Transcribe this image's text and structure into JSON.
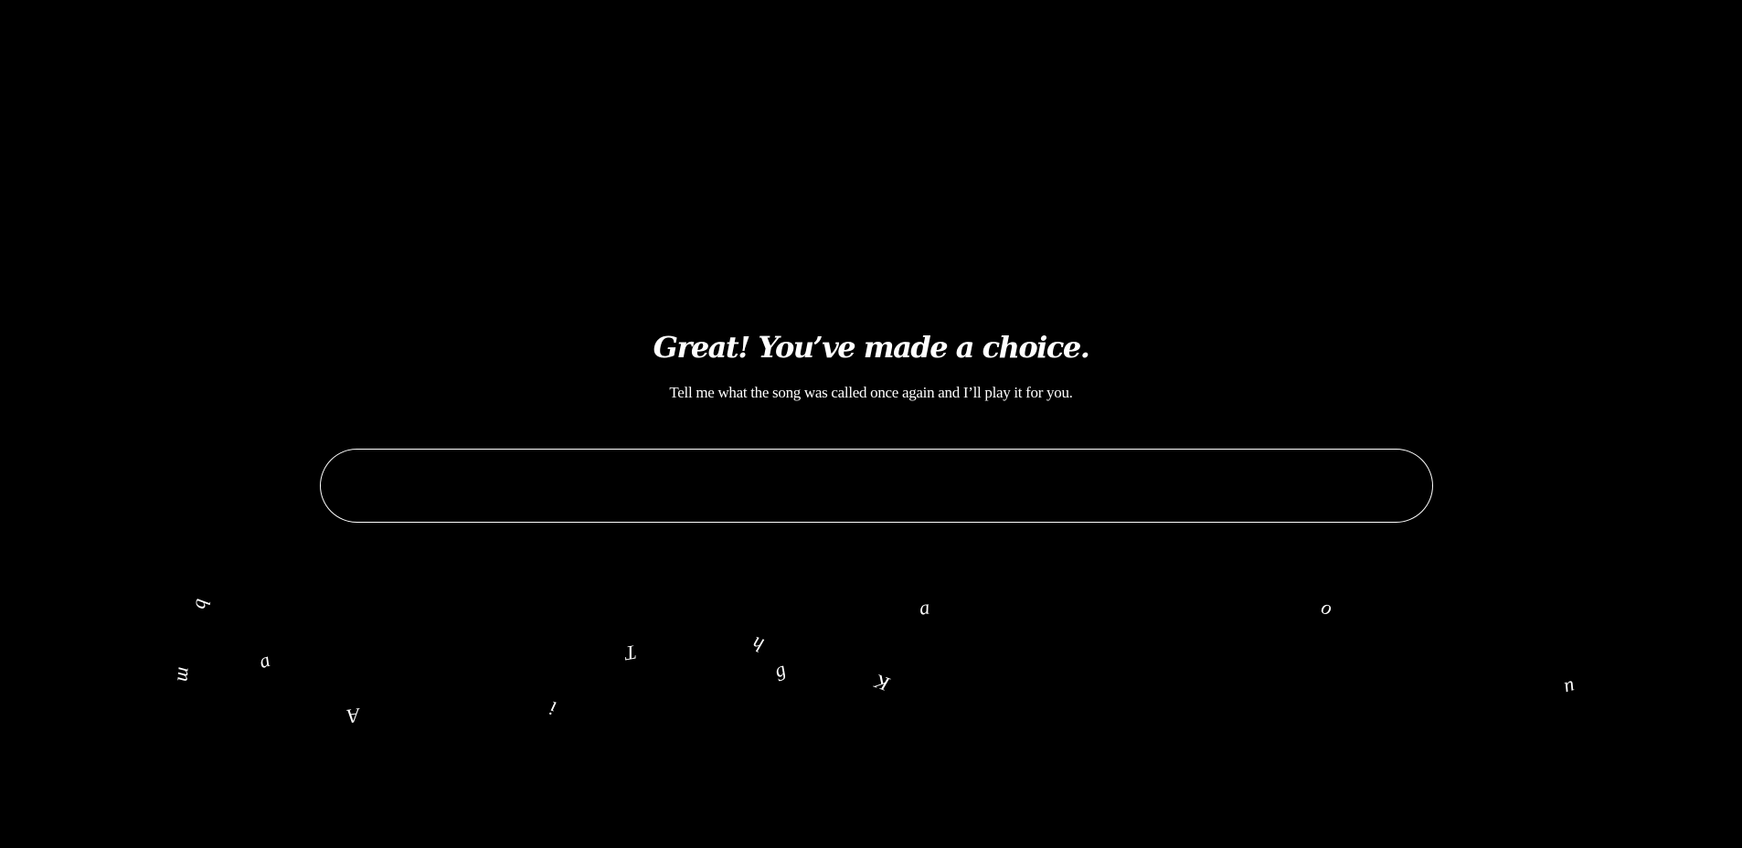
{
  "page": {
    "heading": "Great! You’ve made a choice.",
    "subheading": "Tell me what the song was called once again and I’ll play it for you."
  },
  "search": {
    "value": "",
    "placeholder": ""
  },
  "floating_letters": [
    "b",
    "m",
    "a",
    "A",
    "i",
    "T",
    "h",
    "g",
    "K",
    "a",
    "o",
    "u"
  ],
  "colors": {
    "background": "#000000",
    "foreground": "#ffffff"
  }
}
